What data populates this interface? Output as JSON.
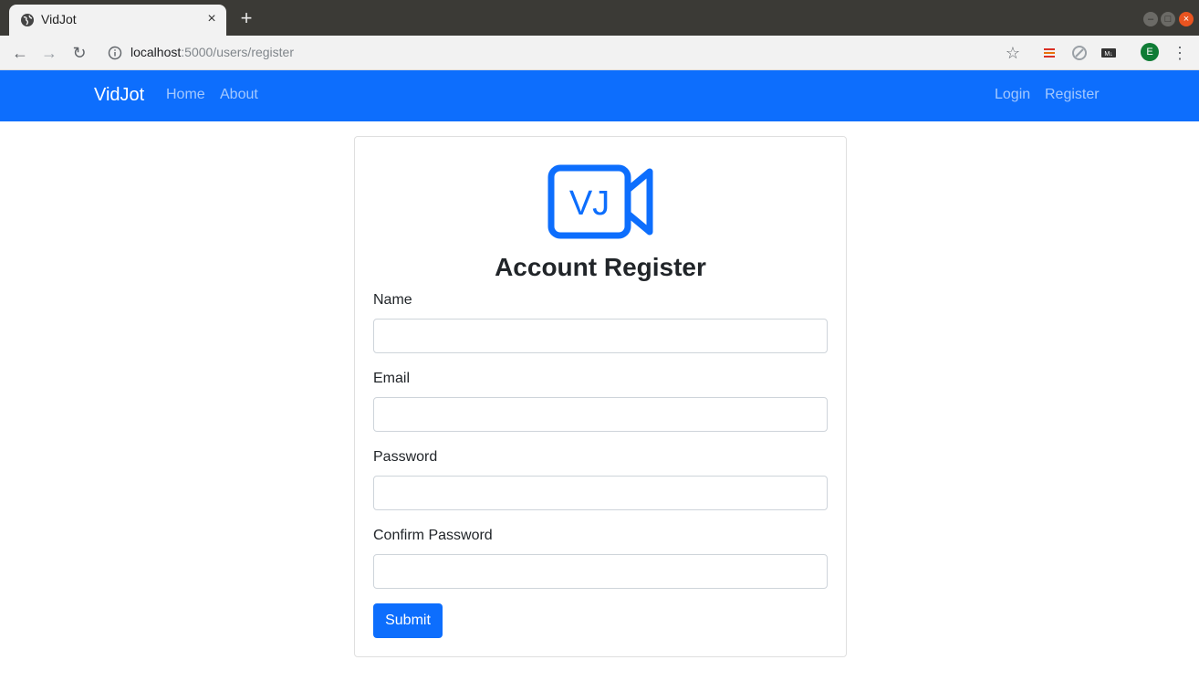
{
  "browser": {
    "tab_title": "VidJot",
    "url_host": "localhost",
    "url_path": ":5000/users/register",
    "avatar_letter": "E",
    "icons": [
      "globe-icon",
      "close-icon",
      "plus-icon",
      "back-icon",
      "forward-icon",
      "reload-icon",
      "info-icon",
      "star-icon",
      "extension-icon",
      "menu-icon"
    ]
  },
  "navbar": {
    "brand": "VidJot",
    "left_links": [
      "Home",
      "About"
    ],
    "right_links": [
      "Login",
      "Register"
    ],
    "bg_color": "#0d6efd"
  },
  "logo": {
    "text": "VJ",
    "color": "#0d6efd",
    "icon": "video-camera-icon"
  },
  "form": {
    "title": "Account Register",
    "fields": [
      {
        "label": "Name",
        "value": ""
      },
      {
        "label": "Email",
        "value": ""
      },
      {
        "label": "Password",
        "value": ""
      },
      {
        "label": "Confirm Password",
        "value": ""
      }
    ],
    "submit_label": "Submit"
  }
}
